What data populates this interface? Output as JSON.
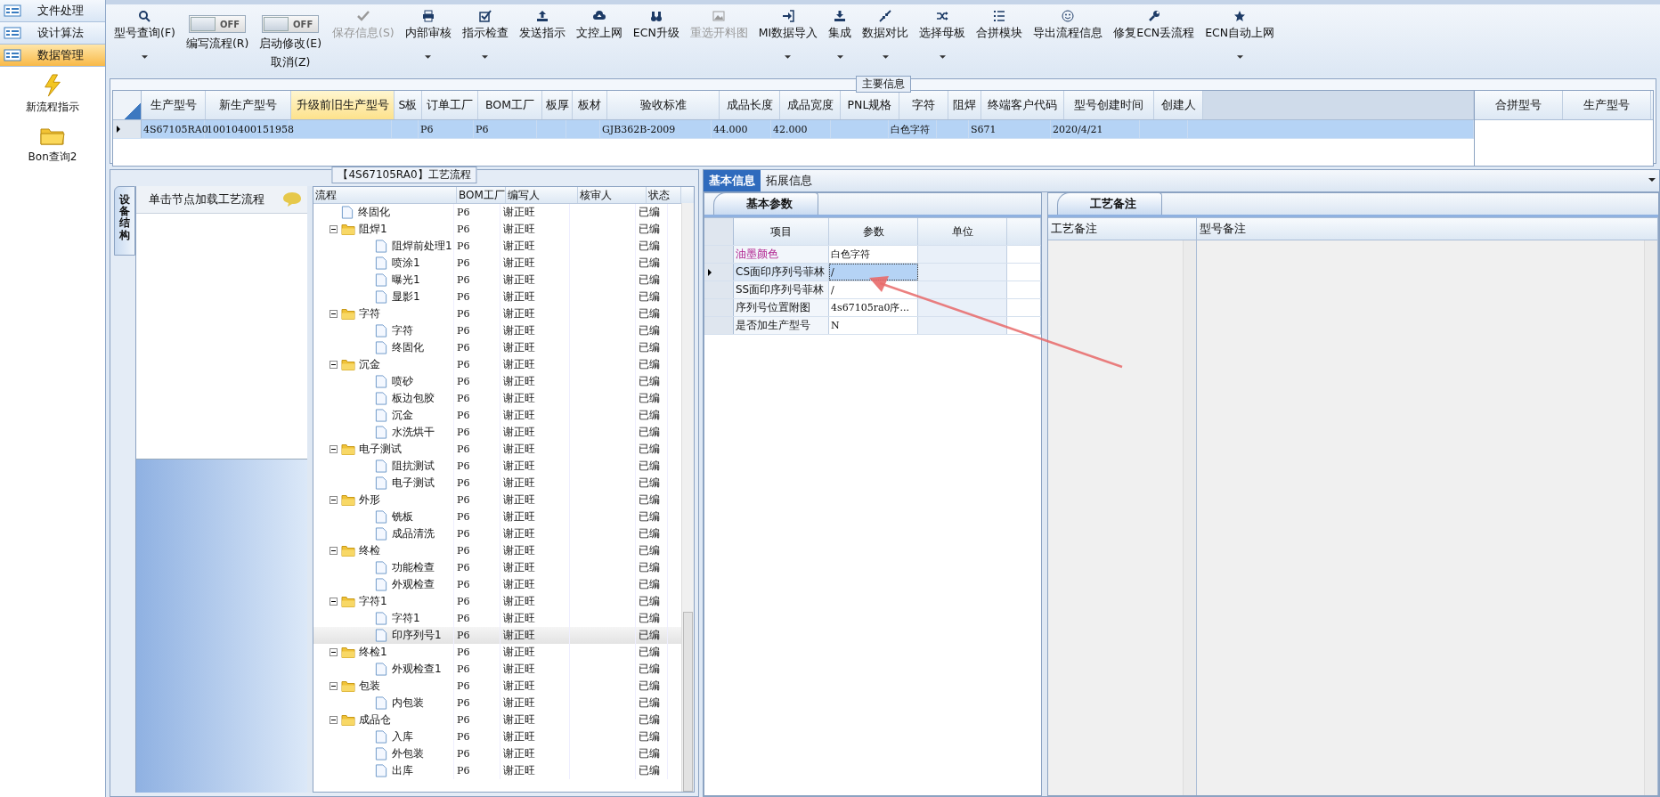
{
  "sidebar": {
    "nav": [
      {
        "label": "文件处理",
        "selected": false
      },
      {
        "label": "设计算法",
        "selected": false
      },
      {
        "label": "数据管理",
        "selected": true
      }
    ],
    "shortcuts": [
      {
        "kind": "bolt",
        "label": "新流程指示"
      },
      {
        "kind": "folder",
        "label": "Bon查询2"
      }
    ]
  },
  "toolbar": [
    {
      "kind": "button",
      "label": "型号查询(F)",
      "disabled": false,
      "menu": true
    },
    {
      "kind": "toggle",
      "label": "编写流程(R)",
      "on": false,
      "state_text": "OFF"
    },
    {
      "kind": "toggle",
      "label": "启动修改(E)",
      "sublabel": "取消(Z)",
      "on": false,
      "state_text": "OFF"
    },
    {
      "kind": "button",
      "label": "保存信息(S)",
      "disabled": true,
      "menu": false
    },
    {
      "kind": "button",
      "label": "内部审核",
      "disabled": false,
      "menu": true
    },
    {
      "kind": "button",
      "label": "指示检查",
      "disabled": false,
      "menu": true
    },
    {
      "kind": "button",
      "label": "发送指示",
      "disabled": false,
      "menu": false
    },
    {
      "kind": "button",
      "label": "文控上网",
      "disabled": false,
      "menu": false
    },
    {
      "kind": "button",
      "label": "ECN升级",
      "disabled": false,
      "menu": false
    },
    {
      "kind": "button",
      "label": "重选开料图",
      "disabled": true,
      "menu": false
    },
    {
      "kind": "button",
      "label": "MI数据导入",
      "disabled": false,
      "menu": true
    },
    {
      "kind": "button",
      "label": "集成",
      "disabled": false,
      "menu": true
    },
    {
      "kind": "button",
      "label": "数据对比",
      "disabled": false,
      "menu": true
    },
    {
      "kind": "button",
      "label": "选择母板",
      "disabled": false,
      "menu": true
    },
    {
      "kind": "button",
      "label": "合拼模块",
      "disabled": false,
      "menu": false
    },
    {
      "kind": "button",
      "label": "导出流程信息",
      "disabled": false,
      "menu": false
    },
    {
      "kind": "button",
      "label": "修复ECN丢流程",
      "disabled": false,
      "menu": false
    },
    {
      "kind": "button",
      "label": "ECN自动上网",
      "disabled": false,
      "menu": true
    }
  ],
  "main_info": {
    "title": "主要信息",
    "columns": [
      {
        "label": "生产型号",
        "highlighted": false,
        "value": "4S67105RA0"
      },
      {
        "label": "新生产型号",
        "highlighted": false,
        "value": "10010400151958"
      },
      {
        "label": "升级前旧生产型号",
        "highlighted": true
      },
      {
        "label": "S板",
        "highlighted": false
      },
      {
        "label": "订单工厂",
        "highlighted": false,
        "value": "P6"
      },
      {
        "label": "BOM工厂",
        "highlighted": false,
        "value": "P6"
      },
      {
        "label": "板厚",
        "highlighted": false
      },
      {
        "label": "板材",
        "highlighted": false
      },
      {
        "label": "验收标准",
        "highlighted": false,
        "value": "GJB362B-2009"
      },
      {
        "label": "成品长度",
        "highlighted": false,
        "value": "44.000"
      },
      {
        "label": "成品宽度",
        "highlighted": false,
        "value": "42.000"
      },
      {
        "label": "PNL规格",
        "highlighted": false
      },
      {
        "label": "字符",
        "highlighted": false,
        "value": "白色字符"
      },
      {
        "label": "阻焊",
        "highlighted": false
      },
      {
        "label": "终端客户代码",
        "highlighted": false,
        "value": "S671"
      },
      {
        "label": "型号创建时间",
        "highlighted": false,
        "value": "2020/4/21"
      },
      {
        "label": "创建人",
        "highlighted": false
      }
    ],
    "merge_columns": [
      "合拼型号",
      "生产型号"
    ]
  },
  "flow_panel": {
    "title": "【4S67105RA0】工艺流程",
    "side_tab": "设备结构",
    "hint": "单击节点加载工艺流程",
    "columns": [
      "流程",
      "BOM工厂",
      "编写人",
      "核审人",
      "状态"
    ],
    "nodes": [
      {
        "kind": "file",
        "label": "终固化",
        "bom": "P6",
        "writer": "谢正旺",
        "status": "已编",
        "selected": false
      },
      {
        "kind": "folder",
        "label": "阻焊1",
        "expanded": true,
        "bom": "P6",
        "writer": "谢正旺",
        "status": "已编",
        "selected": false,
        "children": [
          {
            "kind": "file",
            "label": "阻焊前处理1",
            "bom": "P6",
            "writer": "谢正旺",
            "status": "已编",
            "selected": false
          },
          {
            "kind": "file",
            "label": "喷涂1",
            "bom": "P6",
            "writer": "谢正旺",
            "status": "已编",
            "selected": false
          },
          {
            "kind": "file",
            "label": "曝光1",
            "bom": "P6",
            "writer": "谢正旺",
            "status": "已编",
            "selected": false
          },
          {
            "kind": "file",
            "label": "显影1",
            "bom": "P6",
            "writer": "谢正旺",
            "status": "已编",
            "selected": false
          }
        ]
      },
      {
        "kind": "folder",
        "label": "字符",
        "expanded": true,
        "bom": "P6",
        "writer": "谢正旺",
        "status": "已编",
        "selected": false,
        "children": [
          {
            "kind": "file",
            "label": "字符",
            "bom": "P6",
            "writer": "谢正旺",
            "status": "已编",
            "selected": false
          },
          {
            "kind": "file",
            "label": "终固化",
            "bom": "P6",
            "writer": "谢正旺",
            "status": "已编",
            "selected": false
          }
        ]
      },
      {
        "kind": "folder",
        "label": "沉金",
        "expanded": true,
        "bom": "P6",
        "writer": "谢正旺",
        "status": "已编",
        "selected": false,
        "children": [
          {
            "kind": "file",
            "label": "喷砂",
            "bom": "P6",
            "writer": "谢正旺",
            "status": "已编",
            "selected": false
          },
          {
            "kind": "file",
            "label": "板边包胶",
            "bom": "P6",
            "writer": "谢正旺",
            "status": "已编",
            "selected": false
          },
          {
            "kind": "file",
            "label": "沉金",
            "bom": "P6",
            "writer": "谢正旺",
            "status": "已编",
            "selected": false
          },
          {
            "kind": "file",
            "label": "水洗烘干",
            "bom": "P6",
            "writer": "谢正旺",
            "status": "已编",
            "selected": false
          }
        ]
      },
      {
        "kind": "folder",
        "label": "电子测试",
        "expanded": true,
        "bom": "P6",
        "writer": "谢正旺",
        "status": "已编",
        "selected": false,
        "children": [
          {
            "kind": "file",
            "label": "阻抗测试",
            "bom": "P6",
            "writer": "谢正旺",
            "status": "已编",
            "selected": false
          },
          {
            "kind": "file",
            "label": "电子测试",
            "bom": "P6",
            "writer": "谢正旺",
            "status": "已编",
            "selected": false
          }
        ]
      },
      {
        "kind": "folder",
        "label": "外形",
        "expanded": true,
        "bom": "P6",
        "writer": "谢正旺",
        "status": "已编",
        "selected": false,
        "children": [
          {
            "kind": "file",
            "label": "铣板",
            "bom": "P6",
            "writer": "谢正旺",
            "status": "已编",
            "selected": false
          },
          {
            "kind": "file",
            "label": "成品清洗",
            "bom": "P6",
            "writer": "谢正旺",
            "status": "已编",
            "selected": false
          }
        ]
      },
      {
        "kind": "folder",
        "label": "终检",
        "expanded": true,
        "bom": "P6",
        "writer": "谢正旺",
        "status": "已编",
        "selected": false,
        "children": [
          {
            "kind": "file",
            "label": "功能检查",
            "bom": "P6",
            "writer": "谢正旺",
            "status": "已编",
            "selected": false
          },
          {
            "kind": "file",
            "label": "外观检查",
            "bom": "P6",
            "writer": "谢正旺",
            "status": "已编",
            "selected": false
          }
        ]
      },
      {
        "kind": "folder",
        "label": "字符1",
        "expanded": true,
        "bom": "P6",
        "writer": "谢正旺",
        "status": "已编",
        "selected": false,
        "children": [
          {
            "kind": "file",
            "label": "字符1",
            "bom": "P6",
            "writer": "谢正旺",
            "status": "已编",
            "selected": false
          },
          {
            "kind": "file",
            "label": "印序列号1",
            "bom": "P6",
            "writer": "谢正旺",
            "status": "已编",
            "selected": true
          }
        ]
      },
      {
        "kind": "folder",
        "label": "终检1",
        "expanded": true,
        "bom": "P6",
        "writer": "谢正旺",
        "status": "已编",
        "selected": false,
        "children": [
          {
            "kind": "file",
            "label": "外观检查1",
            "bom": "P6",
            "writer": "谢正旺",
            "status": "已编",
            "selected": false
          }
        ]
      },
      {
        "kind": "folder",
        "label": "包装",
        "expanded": true,
        "bom": "P6",
        "writer": "谢正旺",
        "status": "已编",
        "selected": false,
        "children": [
          {
            "kind": "file",
            "label": "内包装",
            "bom": "P6",
            "writer": "谢正旺",
            "status": "已编",
            "selected": false
          }
        ]
      },
      {
        "kind": "folder",
        "label": "成品仓",
        "expanded": true,
        "bom": "P6",
        "writer": "谢正旺",
        "status": "已编",
        "selected": false,
        "children": [
          {
            "kind": "file",
            "label": "入库",
            "bom": "P6",
            "writer": "谢正旺",
            "status": "已编",
            "selected": false
          },
          {
            "kind": "file",
            "label": "外包装",
            "bom": "P6",
            "writer": "谢正旺",
            "status": "已编",
            "selected": false
          },
          {
            "kind": "file",
            "label": "出库",
            "bom": "P6",
            "writer": "谢正旺",
            "status": "已编",
            "selected": false
          }
        ]
      }
    ]
  },
  "info_tabs": [
    {
      "label": "基本信息",
      "selected": true
    },
    {
      "label": "拓展信息",
      "selected": false
    }
  ],
  "params": {
    "tab": "基本参数",
    "columns": [
      "项目",
      "参数",
      "单位"
    ],
    "rows": [
      {
        "item": "油墨颜色",
        "value": "白色字符",
        "highlighted": true,
        "selected": false
      },
      {
        "item": "CS面印序列号菲林",
        "value": "/",
        "highlighted": false,
        "selected": true
      },
      {
        "item": "SS面印序列号菲林",
        "value": "/",
        "highlighted": false,
        "selected": false
      },
      {
        "item": "序列号位置附图",
        "value": "4s67105ra0序...",
        "highlighted": false,
        "selected": false
      },
      {
        "item": "是否加生产型号",
        "value": "N",
        "highlighted": false,
        "selected": false
      }
    ]
  },
  "notes": {
    "tab": "工艺备注",
    "columns": [
      "工艺备注",
      "型号备注"
    ]
  }
}
